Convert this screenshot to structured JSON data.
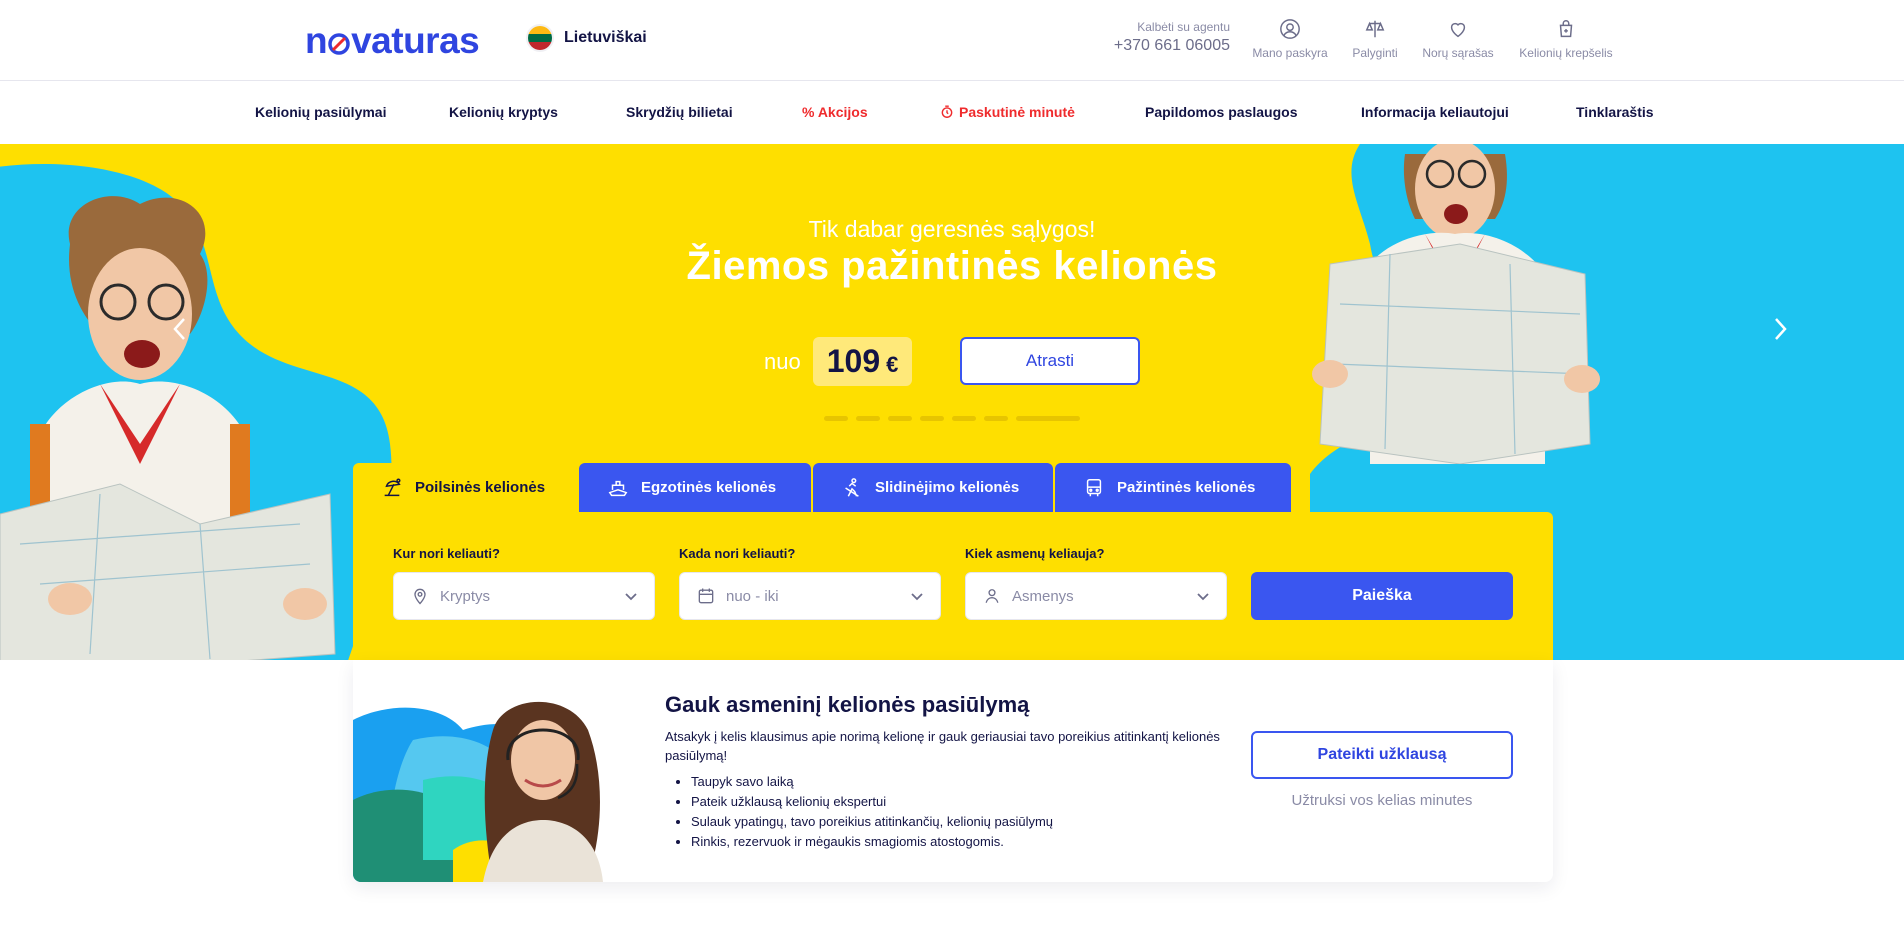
{
  "header": {
    "logo": {
      "part1": "n",
      "part2": "vaturas"
    },
    "language": "Lietuviškai",
    "agent": {
      "label": "Kalbėti su agentu",
      "phone": "+370 661 06005"
    },
    "icons": [
      {
        "name": "user-icon",
        "label": "Mano paskyra"
      },
      {
        "name": "scales-icon",
        "label": "Palyginti"
      },
      {
        "name": "heart-icon",
        "label": "Norų sąrašas"
      },
      {
        "name": "cart-icon",
        "label": "Kelionių krepšelis"
      }
    ]
  },
  "nav": [
    "Kelionių pasiūlymai",
    "Kelionių kryptys",
    "Skrydžių bilietai",
    "% Akcijos",
    "Paskutinė minutė",
    "Papildomos paslaugos",
    "Informacija keliautojui",
    "Tinklaraštis"
  ],
  "hero": {
    "subtitle": "Tik dabar geresnės sąlygos!",
    "title": "Žiemos pažintinės kelionės",
    "from_label": "nuo",
    "price": "109",
    "currency": "€",
    "cta": "Atrasti",
    "slides_count": 8,
    "active_slide": 8
  },
  "search": {
    "tabs": [
      {
        "label": "Poilsinės kelionės",
        "active": true
      },
      {
        "label": "Egzotinės kelionės",
        "active": false
      },
      {
        "label": "Slidinėjimo kelionės",
        "active": false
      },
      {
        "label": "Pažintinės kelionės",
        "active": false
      }
    ],
    "where": {
      "label": "Kur nori keliauti?",
      "placeholder": "Kryptys"
    },
    "when": {
      "label": "Kada nori keliauti?",
      "placeholder": "nuo - iki"
    },
    "who": {
      "label": "Kiek asmenų keliauja?",
      "placeholder": "Asmenys"
    },
    "button": "Paieška"
  },
  "offer": {
    "title": "Gauk asmeninį kelionės pasiūlymą",
    "description": "Atsakyk į kelis klausimus apie norimą kelionę ir gauk geriausiai tavo poreikius atitinkantį kelionės pasiūlymą!",
    "bullets": [
      "Taupyk savo laiką",
      "Pateik užklausą kelionių ekspertui",
      "Sulauk ypatingų, tavo poreikius atitinkančių, kelionių pasiūlymų",
      "Rinkis, rezervuok ir mėgaukis smagiomis atostogomis."
    ],
    "button": "Pateikti užklausą",
    "note": "Užtruksi vos kelias minutes"
  },
  "colors": {
    "brand_blue": "#3a56f0",
    "brand_red": "#ef2b2d",
    "hero_yellow": "#fedf00",
    "hero_cyan": "#1ec3f0",
    "navy_text": "#131445"
  }
}
